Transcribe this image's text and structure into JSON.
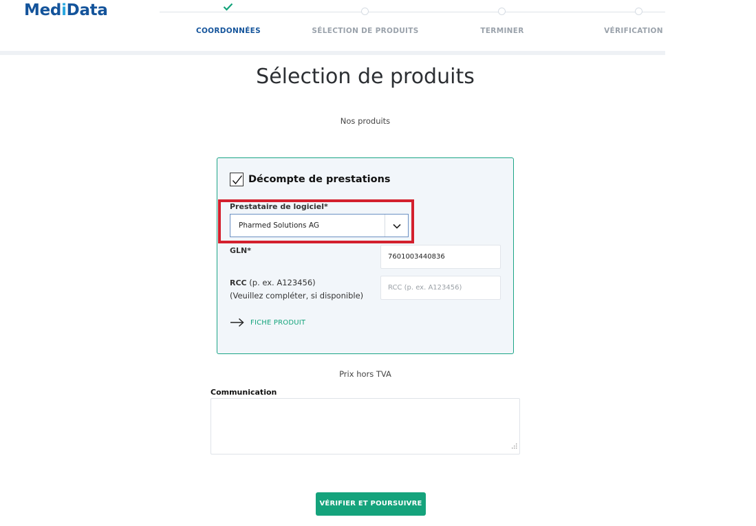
{
  "brand": {
    "logo_prefix": "Med",
    "logo_i": "i",
    "logo_suffix": "Data"
  },
  "steps": [
    {
      "label": "COORDONNÉES",
      "state": "completed"
    },
    {
      "label": "SÉLECTION DE PRODUITS",
      "state": "pending"
    },
    {
      "label": "TERMINER",
      "state": "pending"
    },
    {
      "label": "VÉRIFICATION SI",
      "state": "pending"
    }
  ],
  "main": {
    "title": "Sélection de produits",
    "subtitle": "Nos produits"
  },
  "product": {
    "checked": true,
    "name": "Décompte de prestations",
    "software_label": "Prestataire de logiciel*",
    "software_value": "Pharmed Solutions AG",
    "gln_label": "GLN*",
    "gln_value": "7601003440836",
    "rcc_label_bold": "RCC",
    "rcc_label_rest": " (p. ex. A123456)",
    "rcc_label_line2": "(Veuillez compléter, si disponible)",
    "rcc_placeholder": "RCC (p. ex. A123456)",
    "fiche_label": "FICHE PRODUIT"
  },
  "pricing_note": "Prix hors TVA",
  "communication": {
    "label": "Communication",
    "value": ""
  },
  "submit_label": "VÉRIFIER ET POURSUIVRE",
  "colors": {
    "brand_blue": "#14549b",
    "accent_green": "#15a37c",
    "highlight_red": "#d3202d"
  },
  "icons": [
    "check-icon",
    "checkbox-check-icon",
    "chevron-down-icon",
    "arrow-right-icon",
    "resize-grip-icon"
  ]
}
